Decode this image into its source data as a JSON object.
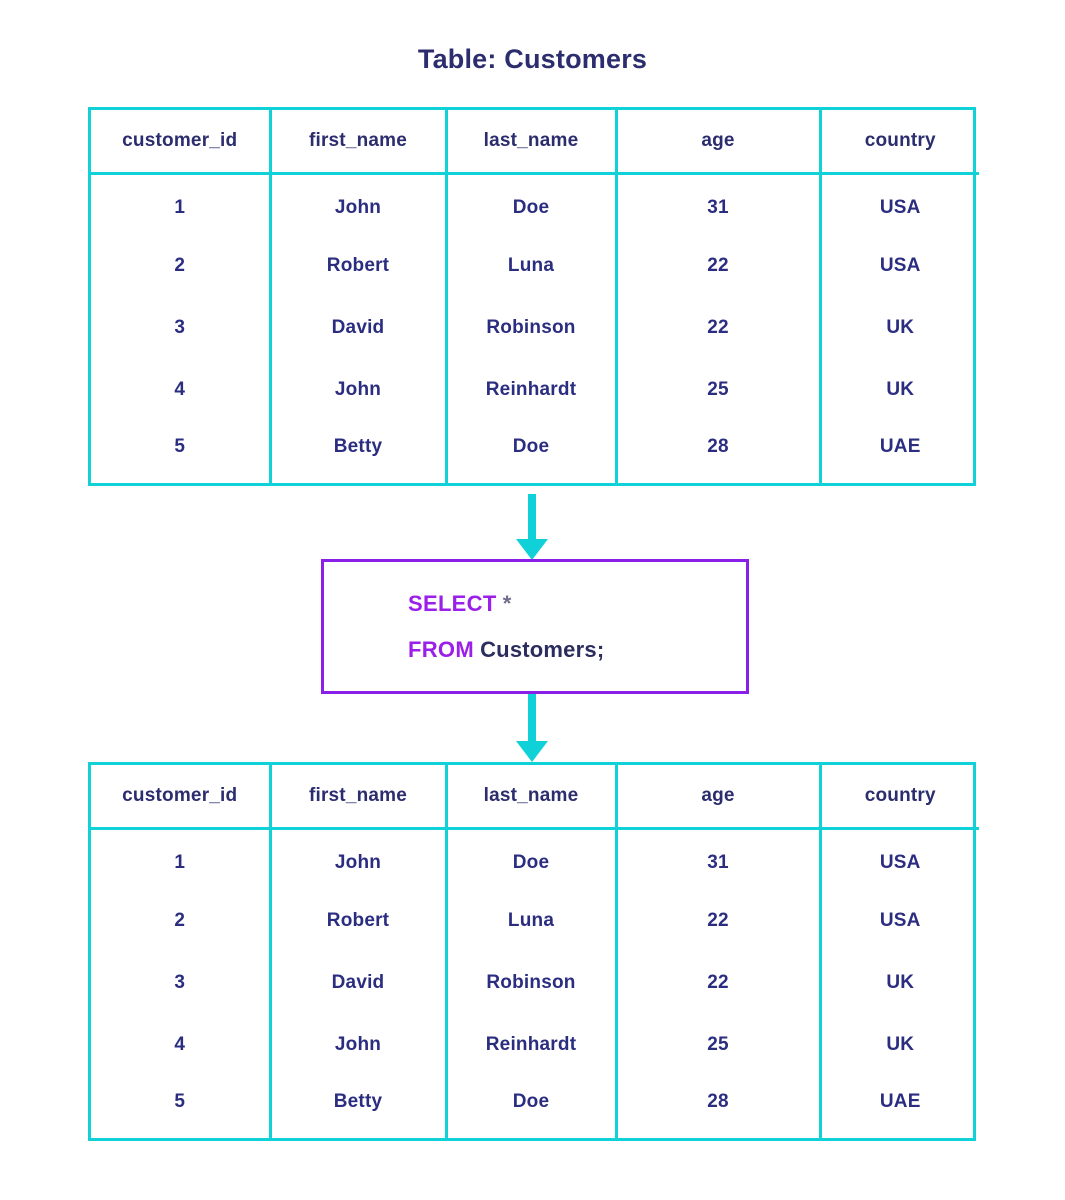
{
  "title": "Table: Customers",
  "colors": {
    "table_border": "#10d0d8",
    "header_text": "#2b2d6e",
    "cell_text": "#2b2d80",
    "query_border": "#8a1fe8",
    "keyword": "#9b1fe8",
    "star": "#6e6e8c",
    "identifier": "#2b2d5e",
    "arrow": "#10d0d8",
    "background": "#ffffff"
  },
  "source_table": {
    "label": "Table: Customers",
    "columns": [
      "customer_id",
      "first_name",
      "last_name",
      "age",
      "country"
    ],
    "rows": [
      [
        "1",
        "John",
        "Doe",
        "31",
        "USA"
      ],
      [
        "2",
        "Robert",
        "Luna",
        "22",
        "USA"
      ],
      [
        "3",
        "David",
        "Robinson",
        "22",
        "UK"
      ],
      [
        "4",
        "John",
        "Reinhardt",
        "25",
        "UK"
      ],
      [
        "5",
        "Betty",
        "Doe",
        "28",
        "UAE"
      ]
    ]
  },
  "query": {
    "line1": {
      "keyword": "SELECT",
      "star": "*"
    },
    "line2": {
      "keyword": "FROM",
      "identifier": "Customers;"
    },
    "full_text": "SELECT * FROM Customers;"
  },
  "result_table": {
    "columns": [
      "customer_id",
      "first_name",
      "last_name",
      "age",
      "country"
    ],
    "rows": [
      [
        "1",
        "John",
        "Doe",
        "31",
        "USA"
      ],
      [
        "2",
        "Robert",
        "Luna",
        "22",
        "USA"
      ],
      [
        "3",
        "David",
        "Robinson",
        "22",
        "UK"
      ],
      [
        "4",
        "John",
        "Reinhardt",
        "25",
        "UK"
      ],
      [
        "5",
        "Betty",
        "Doe",
        "28",
        "UAE"
      ]
    ]
  },
  "arrows": [
    {
      "name": "arrow-table-to-query",
      "direction": "down"
    },
    {
      "name": "arrow-query-to-result",
      "direction": "down"
    }
  ]
}
